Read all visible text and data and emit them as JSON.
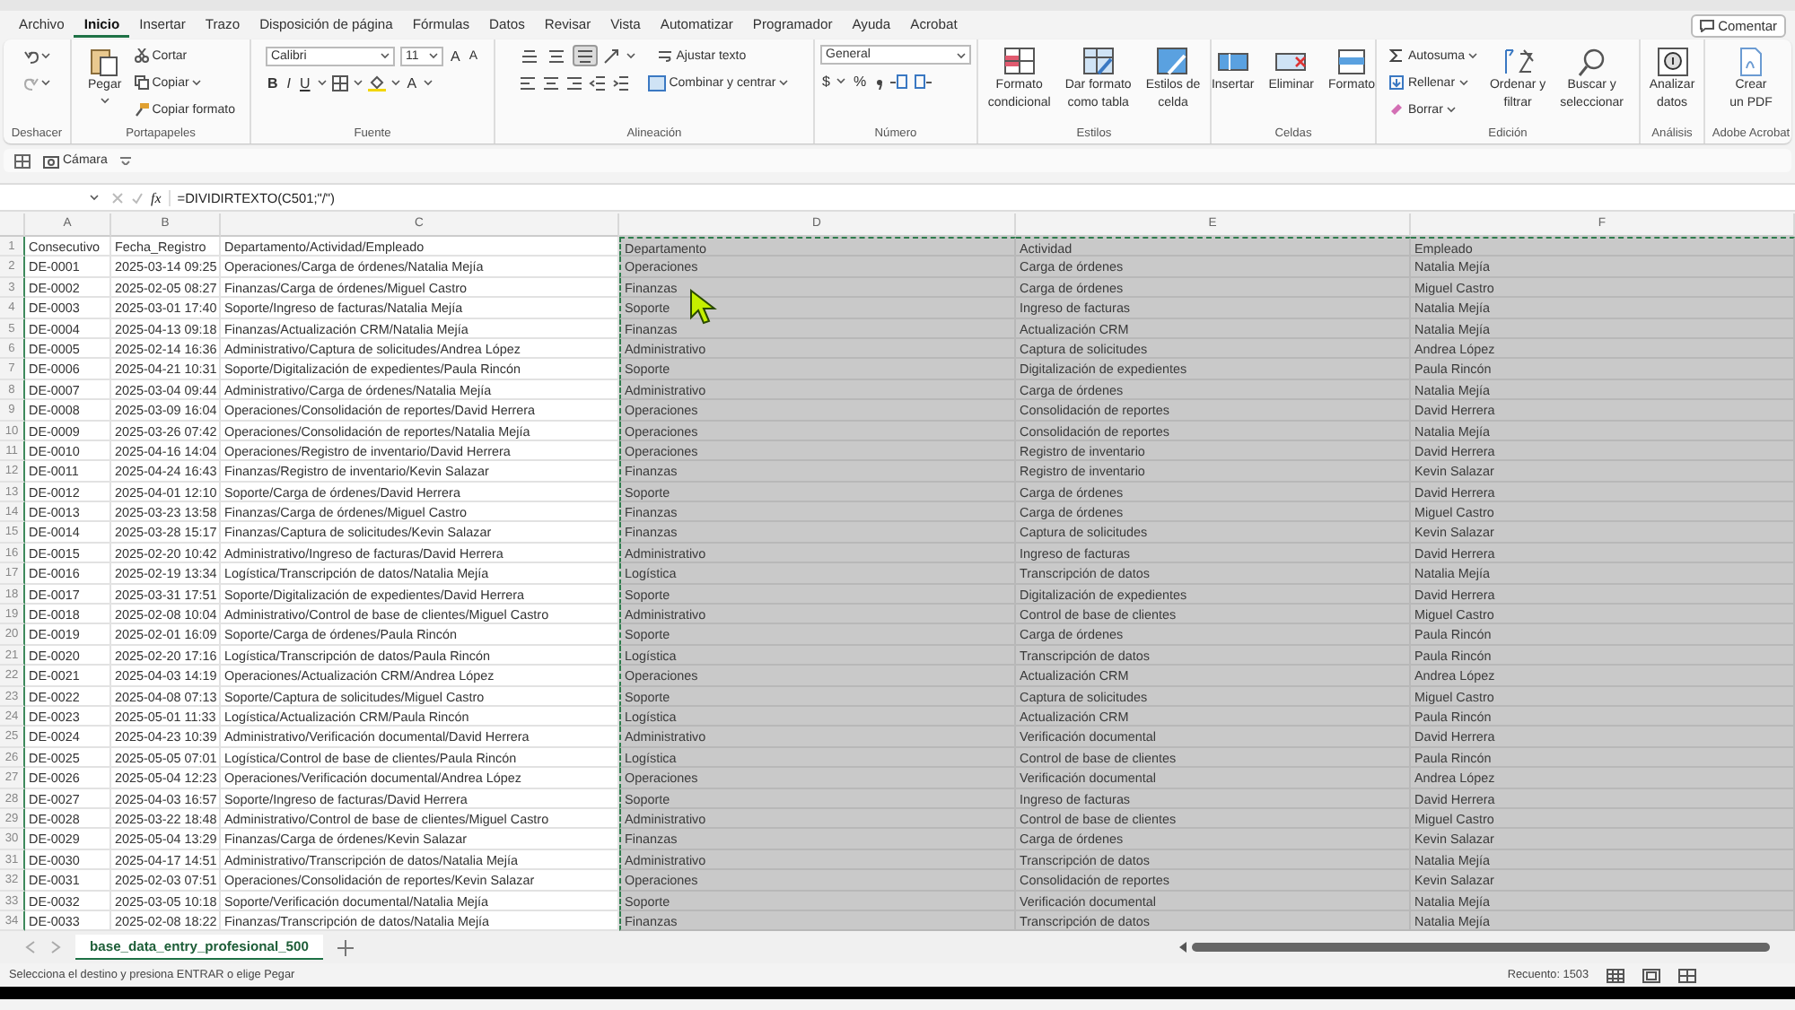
{
  "menu_tabs": [
    {
      "label": "Archivo",
      "selected": false
    },
    {
      "label": "Inicio",
      "selected": true
    },
    {
      "label": "Insertar",
      "selected": false
    },
    {
      "label": "Trazo",
      "selected": false
    },
    {
      "label": "Disposición de página",
      "selected": false
    },
    {
      "label": "Fórmulas",
      "selected": false
    },
    {
      "label": "Datos",
      "selected": false
    },
    {
      "label": "Revisar",
      "selected": false
    },
    {
      "label": "Vista",
      "selected": false
    },
    {
      "label": "Automatizar",
      "selected": false
    },
    {
      "label": "Programador",
      "selected": false
    },
    {
      "label": "Ayuda",
      "selected": false
    },
    {
      "label": "Acrobat",
      "selected": false
    }
  ],
  "comment_button": "Comentar",
  "ribbon": [
    {
      "kind": "undo",
      "label": "Deshacer"
    },
    {
      "kind": "clipboard",
      "label": "Portapapeles",
      "paste": "Pegar",
      "cut": "Cortar",
      "copy": "Copiar",
      "format_painter": "Copiar formato"
    },
    {
      "kind": "font",
      "label": "Fuente",
      "font_name": "Calibri",
      "font_size": "11",
      "grow": "A",
      "shrink": "A",
      "bold": "B",
      "italic": "I",
      "underline": "U",
      "font_color": "A"
    },
    {
      "kind": "alignment",
      "label": "Alineación",
      "vertical_buttons": [
        {
          "selected": false
        },
        {
          "selected": false
        },
        {
          "selected": true
        }
      ],
      "wrap_text": "Ajustar texto",
      "merge": "Combinar y centrar"
    },
    {
      "kind": "number",
      "label": "Número",
      "format": "General",
      "currency": "$",
      "percent": "%"
    },
    {
      "kind": "large",
      "label": "Estilos",
      "items": [
        {
          "lines": [
            "Formato",
            "condicional"
          ]
        },
        {
          "lines": [
            "Dar formato",
            "como tabla"
          ]
        },
        {
          "lines": [
            "Estilos de",
            "celda"
          ]
        }
      ]
    },
    {
      "kind": "large",
      "label": "Celdas",
      "items": [
        {
          "lines": [
            "Insertar"
          ]
        },
        {
          "lines": [
            "Eliminar"
          ]
        },
        {
          "lines": [
            "Formato"
          ]
        }
      ]
    },
    {
      "kind": "editing",
      "label": "Edición",
      "small": [
        "Autosuma",
        "Rellenar",
        "Borrar"
      ],
      "items": [
        {
          "lines": [
            "Ordenar y",
            "filtrar"
          ]
        },
        {
          "lines": [
            "Buscar y",
            "seleccionar"
          ]
        }
      ]
    },
    {
      "kind": "large",
      "label": "Análisis",
      "items": [
        {
          "lines": [
            "Analizar",
            "datos"
          ]
        }
      ]
    },
    {
      "kind": "large",
      "label": "Adobe Acrobat",
      "items": [
        {
          "lines": [
            "Crear",
            "un PDF"
          ]
        }
      ]
    }
  ],
  "quick_access": {
    "camera": "Cámara"
  },
  "formula_bar": {
    "fx": "fx",
    "formula": "=DIVIDIRTEXTO(C501;\"/\")"
  },
  "columns": [
    {
      "letter": "A",
      "copied": false
    },
    {
      "letter": "B",
      "copied": false
    },
    {
      "letter": "C",
      "copied": false
    },
    {
      "letter": "D",
      "copied": true
    },
    {
      "letter": "E",
      "copied": true
    },
    {
      "letter": "F",
      "copied": true
    }
  ],
  "rows": [
    {
      "n": "1",
      "cells": [
        "Consecutivo",
        "Fecha_Registro",
        "Departamento/Actividad/Empleado",
        "Departamento",
        "Actividad",
        "Empleado"
      ]
    },
    {
      "n": "2",
      "cells": [
        "DE-0001",
        "2025-03-14 09:25",
        "Operaciones/Carga de órdenes/Natalia Mejía",
        "Operaciones",
        "Carga de órdenes",
        "Natalia Mejía"
      ]
    },
    {
      "n": "3",
      "cells": [
        "DE-0002",
        "2025-02-05 08:27",
        "Finanzas/Carga de órdenes/Miguel Castro",
        "Finanzas",
        "Carga de órdenes",
        "Miguel Castro"
      ]
    },
    {
      "n": "4",
      "cells": [
        "DE-0003",
        "2025-03-01 17:40",
        "Soporte/Ingreso de facturas/Natalia Mejía",
        "Soporte",
        "Ingreso de facturas",
        "Natalia Mejía"
      ]
    },
    {
      "n": "5",
      "cells": [
        "DE-0004",
        "2025-04-13 09:18",
        "Finanzas/Actualización CRM/Natalia Mejía",
        "Finanzas",
        "Actualización CRM",
        "Natalia Mejía"
      ]
    },
    {
      "n": "6",
      "cells": [
        "DE-0005",
        "2025-02-14 16:36",
        "Administrativo/Captura de solicitudes/Andrea López",
        "Administrativo",
        "Captura de solicitudes",
        "Andrea López"
      ]
    },
    {
      "n": "7",
      "cells": [
        "DE-0006",
        "2025-04-21 10:31",
        "Soporte/Digitalización de expedientes/Paula Rincón",
        "Soporte",
        "Digitalización de expedientes",
        "Paula Rincón"
      ]
    },
    {
      "n": "8",
      "cells": [
        "DE-0007",
        "2025-03-04 09:44",
        "Administrativo/Carga de órdenes/Natalia Mejía",
        "Administrativo",
        "Carga de órdenes",
        "Natalia Mejía"
      ]
    },
    {
      "n": "9",
      "cells": [
        "DE-0008",
        "2025-03-09 16:04",
        "Operaciones/Consolidación de reportes/David Herrera",
        "Operaciones",
        "Consolidación de reportes",
        "David Herrera"
      ]
    },
    {
      "n": "10",
      "cells": [
        "DE-0009",
        "2025-03-26 07:42",
        "Operaciones/Consolidación de reportes/Natalia Mejía",
        "Operaciones",
        "Consolidación de reportes",
        "Natalia Mejía"
      ]
    },
    {
      "n": "11",
      "cells": [
        "DE-0010",
        "2025-04-16 14:04",
        "Operaciones/Registro de inventario/David Herrera",
        "Operaciones",
        "Registro de inventario",
        "David Herrera"
      ]
    },
    {
      "n": "12",
      "cells": [
        "DE-0011",
        "2025-04-24 16:43",
        "Finanzas/Registro de inventario/Kevin Salazar",
        "Finanzas",
        "Registro de inventario",
        "Kevin Salazar"
      ]
    },
    {
      "n": "13",
      "cells": [
        "DE-0012",
        "2025-04-01 12:10",
        "Soporte/Carga de órdenes/David Herrera",
        "Soporte",
        "Carga de órdenes",
        "David Herrera"
      ]
    },
    {
      "n": "14",
      "cells": [
        "DE-0013",
        "2025-03-23 13:58",
        "Finanzas/Carga de órdenes/Miguel Castro",
        "Finanzas",
        "Carga de órdenes",
        "Miguel Castro"
      ]
    },
    {
      "n": "15",
      "cells": [
        "DE-0014",
        "2025-03-28 15:17",
        "Finanzas/Captura de solicitudes/Kevin Salazar",
        "Finanzas",
        "Captura de solicitudes",
        "Kevin Salazar"
      ]
    },
    {
      "n": "16",
      "cells": [
        "DE-0015",
        "2025-02-20 10:42",
        "Administrativo/Ingreso de facturas/David Herrera",
        "Administrativo",
        "Ingreso de facturas",
        "David Herrera"
      ]
    },
    {
      "n": "17",
      "cells": [
        "DE-0016",
        "2025-02-19 13:34",
        "Logística/Transcripción de datos/Natalia Mejía",
        "Logística",
        "Transcripción de datos",
        "Natalia Mejía"
      ]
    },
    {
      "n": "18",
      "cells": [
        "DE-0017",
        "2025-03-31 17:51",
        "Soporte/Digitalización de expedientes/David Herrera",
        "Soporte",
        "Digitalización de expedientes",
        "David Herrera"
      ]
    },
    {
      "n": "19",
      "cells": [
        "DE-0018",
        "2025-02-08 10:04",
        "Administrativo/Control de base de clientes/Miguel Castro",
        "Administrativo",
        "Control de base de clientes",
        "Miguel Castro"
      ]
    },
    {
      "n": "20",
      "cells": [
        "DE-0019",
        "2025-02-01 16:09",
        "Soporte/Carga de órdenes/Paula Rincón",
        "Soporte",
        "Carga de órdenes",
        "Paula Rincón"
      ]
    },
    {
      "n": "21",
      "cells": [
        "DE-0020",
        "2025-02-20 17:16",
        "Logística/Transcripción de datos/Paula Rincón",
        "Logística",
        "Transcripción de datos",
        "Paula Rincón"
      ]
    },
    {
      "n": "22",
      "cells": [
        "DE-0021",
        "2025-04-03 14:19",
        "Operaciones/Actualización CRM/Andrea López",
        "Operaciones",
        "Actualización CRM",
        "Andrea López"
      ]
    },
    {
      "n": "23",
      "cells": [
        "DE-0022",
        "2025-04-08 07:13",
        "Soporte/Captura de solicitudes/Miguel Castro",
        "Soporte",
        "Captura de solicitudes",
        "Miguel Castro"
      ]
    },
    {
      "n": "24",
      "cells": [
        "DE-0023",
        "2025-05-01 11:33",
        "Logística/Actualización CRM/Paula Rincón",
        "Logística",
        "Actualización CRM",
        "Paula Rincón"
      ]
    },
    {
      "n": "25",
      "cells": [
        "DE-0024",
        "2025-04-23 10:39",
        "Administrativo/Verificación documental/David Herrera",
        "Administrativo",
        "Verificación documental",
        "David Herrera"
      ]
    },
    {
      "n": "26",
      "cells": [
        "DE-0025",
        "2025-05-05 07:01",
        "Logística/Control de base de clientes/Paula Rincón",
        "Logística",
        "Control de base de clientes",
        "Paula Rincón"
      ]
    },
    {
      "n": "27",
      "cells": [
        "DE-0026",
        "2025-05-04 12:23",
        "Operaciones/Verificación documental/Andrea López",
        "Operaciones",
        "Verificación documental",
        "Andrea López"
      ]
    },
    {
      "n": "28",
      "cells": [
        "DE-0027",
        "2025-04-03 16:57",
        "Soporte/Ingreso de facturas/David Herrera",
        "Soporte",
        "Ingreso de facturas",
        "David Herrera"
      ]
    },
    {
      "n": "29",
      "cells": [
        "DE-0028",
        "2025-03-22 18:48",
        "Administrativo/Control de base de clientes/Miguel Castro",
        "Administrativo",
        "Control de base de clientes",
        "Miguel Castro"
      ]
    },
    {
      "n": "30",
      "cells": [
        "DE-0029",
        "2025-05-04 13:29",
        "Finanzas/Carga de órdenes/Kevin Salazar",
        "Finanzas",
        "Carga de órdenes",
        "Kevin Salazar"
      ]
    },
    {
      "n": "31",
      "cells": [
        "DE-0030",
        "2025-04-17 14:51",
        "Administrativo/Transcripción de datos/Natalia Mejía",
        "Administrativo",
        "Transcripción de datos",
        "Natalia Mejía"
      ]
    },
    {
      "n": "32",
      "cells": [
        "DE-0031",
        "2025-02-03 07:51",
        "Operaciones/Consolidación de reportes/Kevin Salazar",
        "Operaciones",
        "Consolidación de reportes",
        "Kevin Salazar"
      ]
    },
    {
      "n": "33",
      "cells": [
        "DE-0032",
        "2025-03-05 10:18",
        "Soporte/Verificación documental/Natalia Mejía",
        "Soporte",
        "Verificación documental",
        "Natalia Mejía"
      ]
    },
    {
      "n": "34",
      "cells": [
        "DE-0033",
        "2025-02-08 18:22",
        "Finanzas/Transcripción de datos/Natalia Mejía",
        "Finanzas",
        "Transcripción de datos",
        "Natalia Mejía"
      ]
    }
  ],
  "sheet_tabs": [
    {
      "label": "base_data_entry_profesional_500",
      "selected": true
    }
  ],
  "status_bar": {
    "message": "Selecciona el destino y presiona ENTRAR o elige Pegar",
    "count": "Recuento: 1503"
  }
}
